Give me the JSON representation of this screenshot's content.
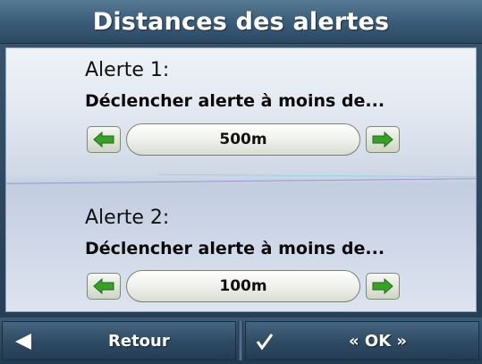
{
  "title": "Distances des alertes",
  "alerts": [
    {
      "label": "Alerte 1:",
      "description": "Déclencher alerte à moins de...",
      "value": "500m"
    },
    {
      "label": "Alerte 2:",
      "description": "Déclencher alerte à moins de...",
      "value": "100m"
    }
  ],
  "footer": {
    "back_label": "Retour",
    "back_icon": "triangle-left-icon",
    "ok_label": "« OK »",
    "ok_icon": "checkmark-icon"
  },
  "colors": {
    "arrow_green": "#3aa02a",
    "title_bar": "#3d5f7b",
    "panel_bg": "#dfe5ef"
  }
}
